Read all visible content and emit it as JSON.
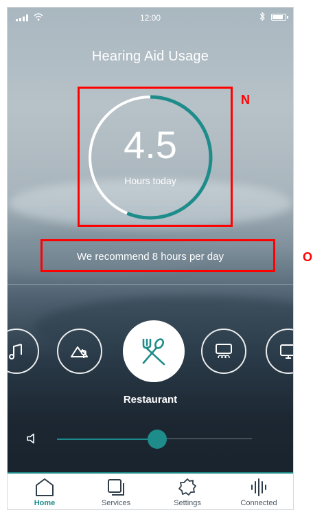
{
  "status_bar": {
    "time": "12:00"
  },
  "header": {
    "title": "Hearing Aid Usage"
  },
  "usage": {
    "value": "4.5",
    "label": "Hours today",
    "recommendation": "We recommend 8 hours per day",
    "progress_fraction": 0.5625
  },
  "annotations": {
    "box_n": "N",
    "box_o": "O"
  },
  "programs": {
    "items": [
      "music-icon",
      "outdoor-icon",
      "restaurant-icon",
      "audience-icon",
      "tv-icon"
    ],
    "selected_label": "Restaurant"
  },
  "volume": {
    "level_fraction": 0.52
  },
  "tabs": [
    {
      "label": "Home",
      "icon": "home-icon",
      "active": true
    },
    {
      "label": "Services",
      "icon": "services-icon",
      "active": false
    },
    {
      "label": "Settings",
      "icon": "settings-icon",
      "active": false
    },
    {
      "label": "Connected",
      "icon": "connected-icon",
      "active": false
    }
  ],
  "colors": {
    "accent": "#1e8c8a",
    "annotation": "#ff0000",
    "tab_text": "#4b5a66"
  }
}
